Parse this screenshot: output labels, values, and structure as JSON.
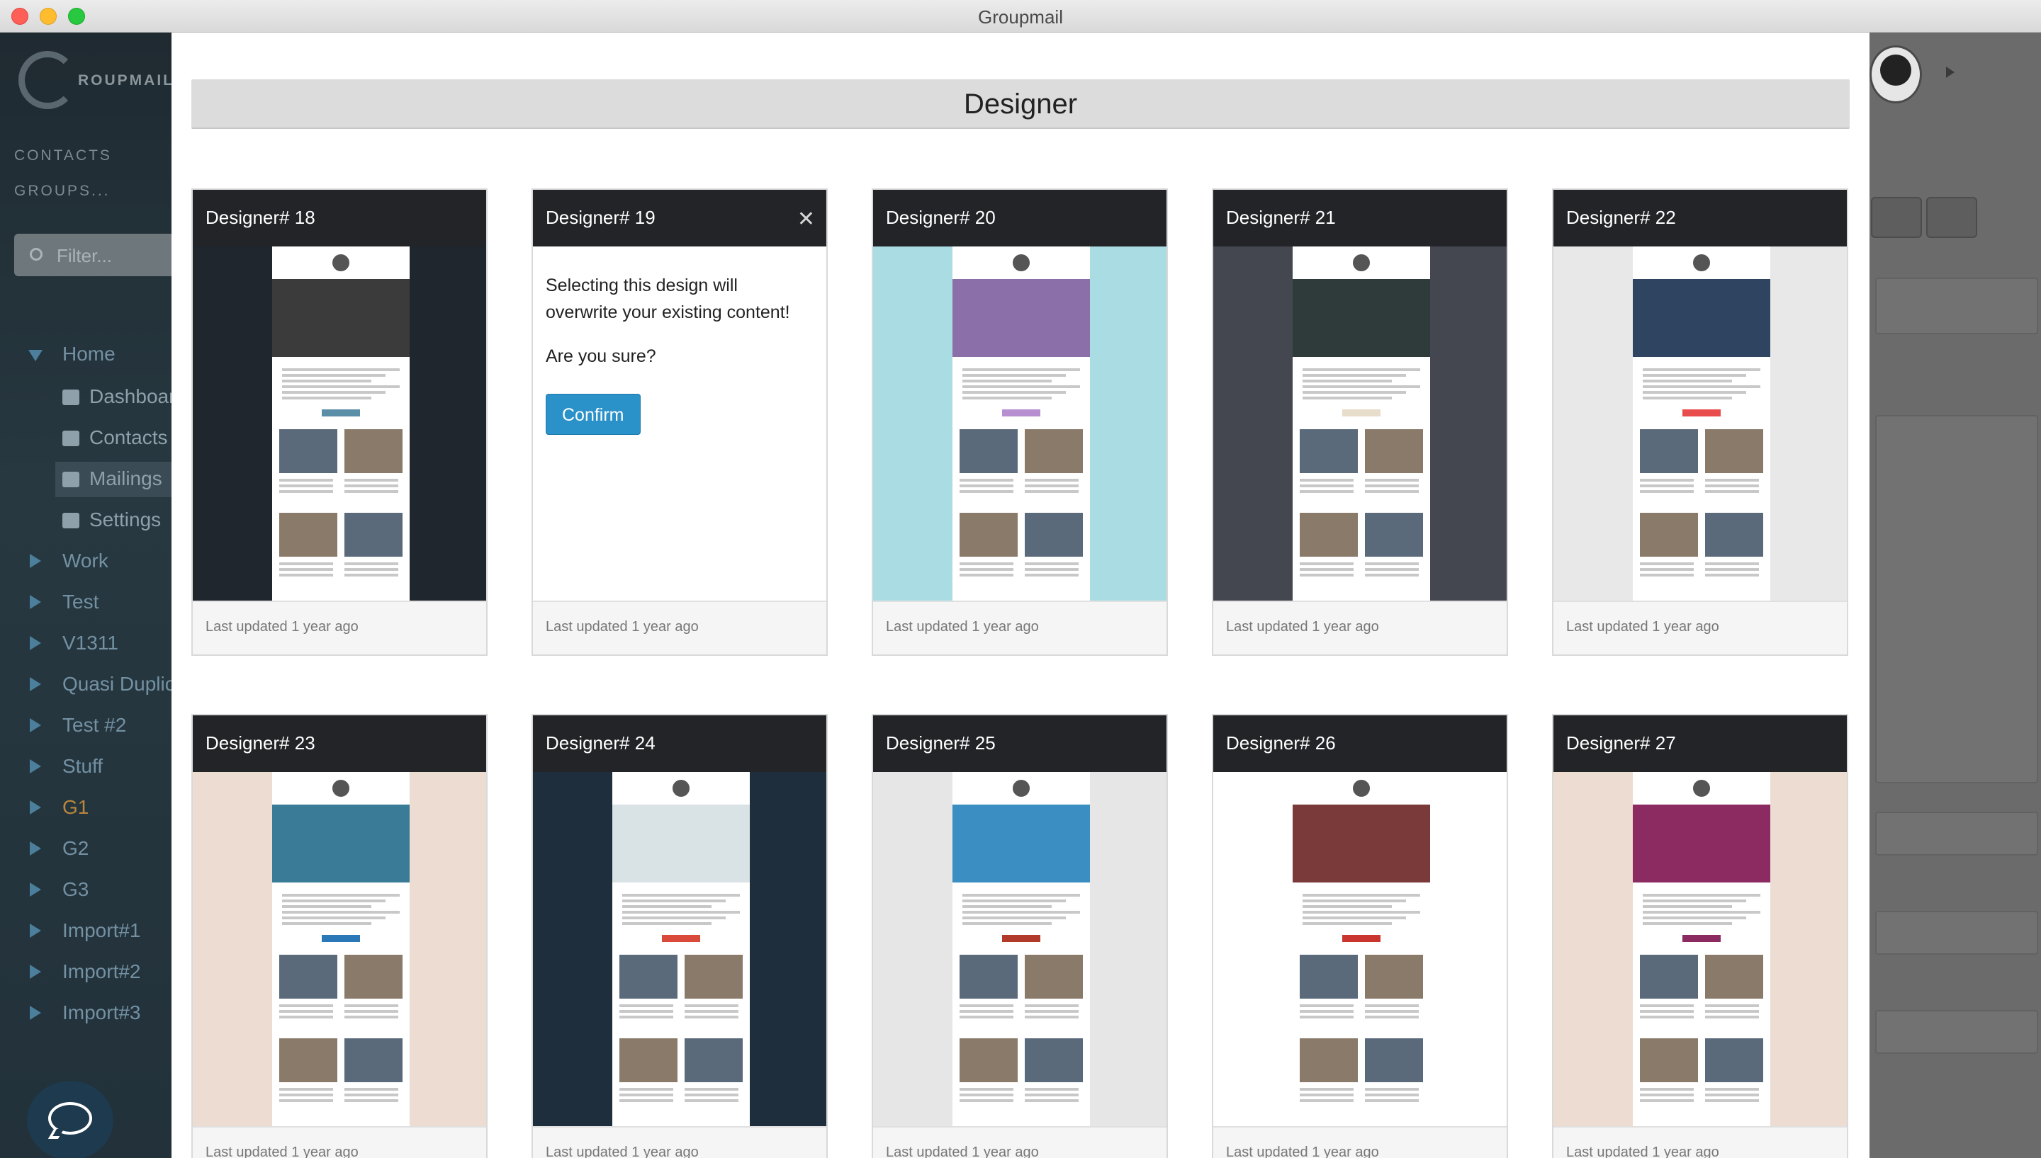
{
  "window": {
    "title": "Groupmail"
  },
  "sidebar": {
    "logo_text": "ROUPMAIL",
    "links": [
      "CONTACTS",
      "GROUPS..."
    ],
    "filter_placeholder": "Filter...",
    "tree": [
      {
        "label": "Home",
        "expanded": true
      },
      {
        "label": "Work"
      },
      {
        "label": "Test"
      },
      {
        "label": "V1311"
      },
      {
        "label": "Quasi Duplic"
      },
      {
        "label": "Test #2"
      },
      {
        "label": "Stuff"
      },
      {
        "label": "G1"
      },
      {
        "label": "G2"
      },
      {
        "label": "G3"
      },
      {
        "label": "Import#1"
      },
      {
        "label": "Import#2"
      },
      {
        "label": "Import#3"
      }
    ],
    "home_children": [
      {
        "label": "Dashboar",
        "icon": "home-icon"
      },
      {
        "label": "Contacts",
        "icon": "users-icon"
      },
      {
        "label": "Mailings",
        "icon": "envelope-icon",
        "active": true
      },
      {
        "label": "Settings",
        "icon": "gear-icon"
      }
    ]
  },
  "modal": {
    "title": "Designer",
    "confirm": {
      "message": "Selecting this design will overwrite your existing content!",
      "question": "Are you sure?",
      "button": "Confirm",
      "close": "✕"
    },
    "cards": [
      {
        "title": "Designer# 18",
        "footer": "Last updated 1 year ago",
        "theme": {
          "bg": "#1f262d",
          "hero": "#3b3b3b",
          "accent": "#5b8fa8"
        }
      },
      {
        "title": "Designer# 19",
        "footer": "Last updated 1 year ago",
        "confirm": true
      },
      {
        "title": "Designer# 20",
        "footer": "Last updated 1 year ago",
        "theme": {
          "bg": "#a9dde3",
          "hero": "#8a6fa8",
          "accent": "#b78ed0"
        }
      },
      {
        "title": "Designer# 21",
        "footer": "Last updated 1 year ago",
        "theme": {
          "bg": "#44474f",
          "hero": "#2e3b3a",
          "accent": "#e8dccb"
        }
      },
      {
        "title": "Designer# 22",
        "footer": "Last updated 1 year ago",
        "theme": {
          "bg": "#e8e8e8",
          "hero": "#2f4460",
          "accent": "#e84c4c"
        }
      },
      {
        "title": "Designer# 23",
        "footer": "Last updated 1 year ago",
        "theme": {
          "bg": "#ecdcd2",
          "hero": "#3a7c98",
          "accent": "#2a78b8"
        }
      },
      {
        "title": "Designer# 24",
        "footer": "Last updated 1 year ago",
        "theme": {
          "bg": "#1f2e3c",
          "hero": "#d9e3e6",
          "accent": "#d94a3a"
        }
      },
      {
        "title": "Designer# 25",
        "footer": "Last updated 1 year ago",
        "theme": {
          "bg": "#e6e6e6",
          "hero": "#3a8ec2",
          "accent": "#b23a2a"
        }
      },
      {
        "title": "Designer# 26",
        "footer": "Last updated 1 year ago",
        "theme": {
          "bg": "#ffffff",
          "hero": "#7a3a3a",
          "accent": "#c9362f"
        }
      },
      {
        "title": "Designer# 27",
        "footer": "Last updated 1 year ago",
        "theme": {
          "bg": "#ecdcd2",
          "hero": "#8c2a62",
          "accent": "#8c2a62"
        }
      }
    ]
  }
}
